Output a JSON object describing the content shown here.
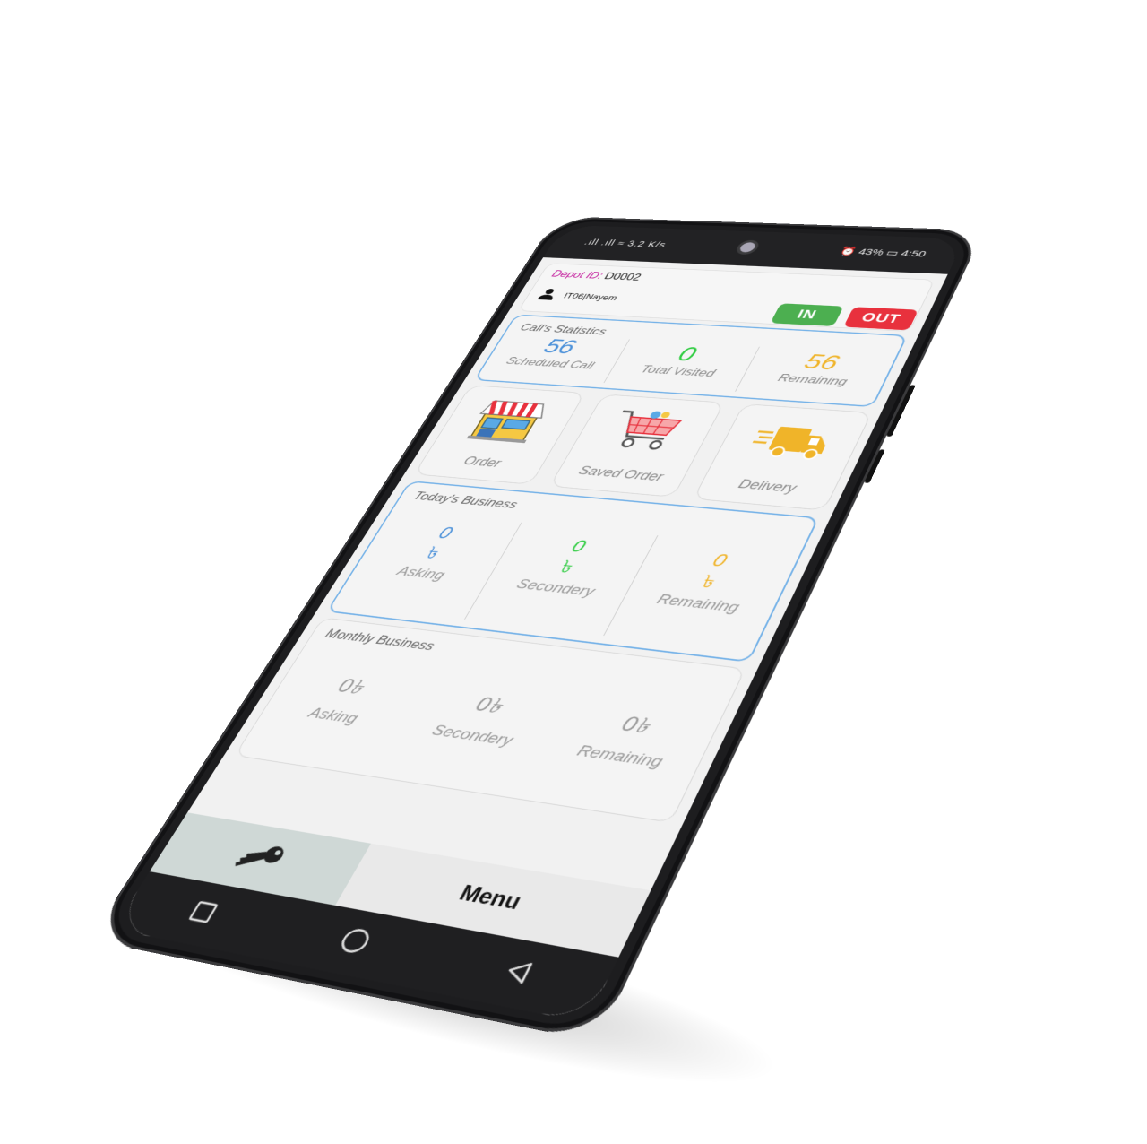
{
  "status_bar": {
    "left_text": ".ıll .ıll ≈ 3.2 K/s",
    "battery": "43%",
    "time": "4:50"
  },
  "header": {
    "depot_label": "Depot ID:",
    "depot_id": "D0002",
    "user": "IT06|Nayem",
    "in_label": "IN",
    "out_label": "OUT"
  },
  "calls": {
    "title": "Call's Statistics",
    "items": [
      {
        "value": "56",
        "label": "Scheduled Call",
        "color": "#4a90d9"
      },
      {
        "value": "0",
        "label": "Total Visited",
        "color": "#2ecc40"
      },
      {
        "value": "56",
        "label": "Remaining",
        "color": "#f0b429"
      }
    ]
  },
  "tiles": [
    {
      "label": "Order",
      "icon": "shop-icon"
    },
    {
      "label": "Saved Order",
      "icon": "cart-icon"
    },
    {
      "label": "Delivery",
      "icon": "truck-icon"
    }
  ],
  "today": {
    "title": "Today's Business",
    "currency": "৳",
    "items": [
      {
        "value": "0",
        "label": "Asking",
        "color": "#4a90d9"
      },
      {
        "value": "0",
        "label": "Secondery",
        "color": "#2ecc40"
      },
      {
        "value": "0",
        "label": "Remaining",
        "color": "#f0b429"
      }
    ]
  },
  "monthly": {
    "title": "Monthly Business",
    "items": [
      {
        "value": "0৳",
        "label": "Asking"
      },
      {
        "value": "0৳",
        "label": "Secondery"
      },
      {
        "value": "0৳",
        "label": "Remaining"
      }
    ]
  },
  "bottom_nav": {
    "menu_label": "Menu"
  }
}
